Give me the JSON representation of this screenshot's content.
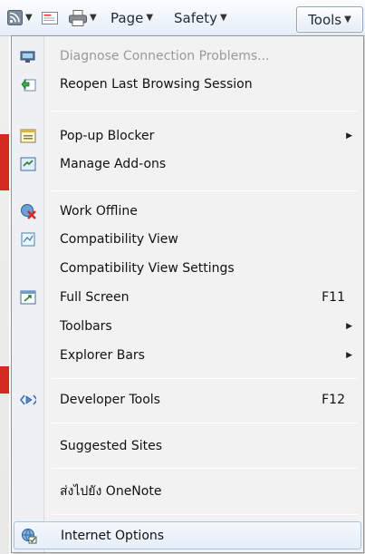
{
  "toolbar": {
    "page_label": "Page",
    "safety_label": "Safety",
    "tools_label": "Tools"
  },
  "menu": {
    "items": [
      {
        "label": "Diagnose Connection Problems...",
        "icon": "network-diagnose-icon",
        "disabled": true
      },
      {
        "label": "Reopen Last Browsing Session",
        "icon": "reopen-session-icon"
      },
      {
        "label": "Pop-up Blocker",
        "icon": "popup-blocker-icon",
        "submenu": true
      },
      {
        "label": "Manage Add-ons",
        "icon": "addons-icon"
      },
      {
        "label": "Work Offline",
        "icon": "work-offline-icon"
      },
      {
        "label": "Compatibility View",
        "icon": "compatibility-icon"
      },
      {
        "label": "Compatibility View Settings"
      },
      {
        "label": "Full Screen",
        "icon": "full-screen-icon",
        "shortcut": "F11"
      },
      {
        "label": "Toolbars",
        "submenu": true
      },
      {
        "label": "Explorer Bars",
        "submenu": true
      },
      {
        "label": "Developer Tools",
        "icon": "developer-tools-icon",
        "shortcut": "F12"
      },
      {
        "label": "Suggested Sites"
      },
      {
        "label": "ส่งไปยัง OneNote"
      },
      {
        "label": "Internet Options",
        "icon": "internet-options-icon",
        "highlighted": true
      }
    ]
  }
}
